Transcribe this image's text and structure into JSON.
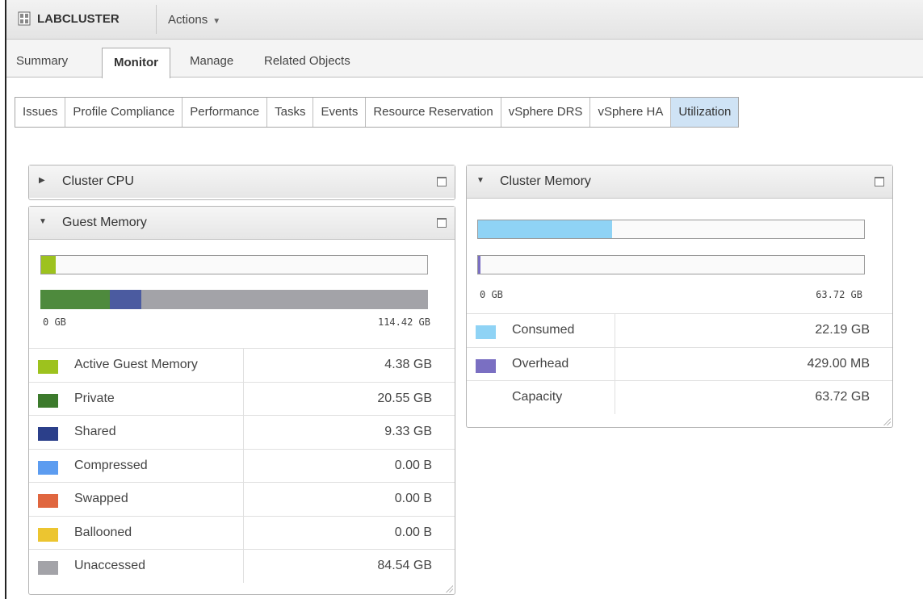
{
  "header": {
    "object_name": "LABCLUSTER",
    "object_icon": "cluster-icon",
    "actions_label": "Actions"
  },
  "tabs": [
    {
      "label": "Summary",
      "active": false
    },
    {
      "label": "Monitor",
      "active": true
    },
    {
      "label": "Manage",
      "active": false
    },
    {
      "label": "Related Objects",
      "active": false
    }
  ],
  "subtabs": [
    {
      "label": "Issues",
      "active": false
    },
    {
      "label": "Profile Compliance",
      "active": false
    },
    {
      "label": "Performance",
      "active": false
    },
    {
      "label": "Tasks",
      "active": false
    },
    {
      "label": "Events",
      "active": false
    },
    {
      "label": "Resource Reservation",
      "active": false
    },
    {
      "label": "vSphere DRS",
      "active": false
    },
    {
      "label": "vSphere HA",
      "active": false
    },
    {
      "label": "Utilization",
      "active": true
    }
  ],
  "cluster_cpu": {
    "title": "Cluster CPU",
    "collapsed": true
  },
  "guest_memory": {
    "title": "Guest Memory",
    "active_bar_fraction": 0.038,
    "breakdown_bar": [
      {
        "name": "Private",
        "fraction": 0.1796,
        "color": "#4e8a3d"
      },
      {
        "name": "Shared",
        "fraction": 0.0816,
        "color": "#4b5ba0"
      },
      {
        "name": "Unaccessed",
        "fraction": 0.7388,
        "color": "#a3a3a8"
      }
    ],
    "scale_min": "0 GB",
    "scale_max": "114.42 GB",
    "legend": [
      {
        "label": "Active Guest Memory",
        "value": "4.38 GB",
        "color": "#9dc21e"
      },
      {
        "label": "Private",
        "value": "20.55 GB",
        "color": "#3c7a2c"
      },
      {
        "label": "Shared",
        "value": "9.33 GB",
        "color": "#2b3f8a"
      },
      {
        "label": "Compressed",
        "value": "0.00 B",
        "color": "#5c9cf0"
      },
      {
        "label": "Swapped",
        "value": "0.00 B",
        "color": "#e0663f"
      },
      {
        "label": "Ballooned",
        "value": "0.00 B",
        "color": "#ecc530"
      },
      {
        "label": "Unaccessed",
        "value": "84.54 GB",
        "color": "#a3a3a8"
      }
    ]
  },
  "cluster_memory": {
    "title": "Cluster Memory",
    "consumed_fraction": 0.348,
    "overhead_fraction": 0.0066,
    "scale_min": "0 GB",
    "scale_max": "63.72 GB",
    "legend": [
      {
        "label": "Consumed",
        "value": "22.19 GB",
        "color": "#8fd3f5"
      },
      {
        "label": "Overhead",
        "value": "429.00 MB",
        "color": "#7a6fc2"
      },
      {
        "label": "Capacity",
        "value": "63.72 GB",
        "color": ""
      }
    ]
  }
}
